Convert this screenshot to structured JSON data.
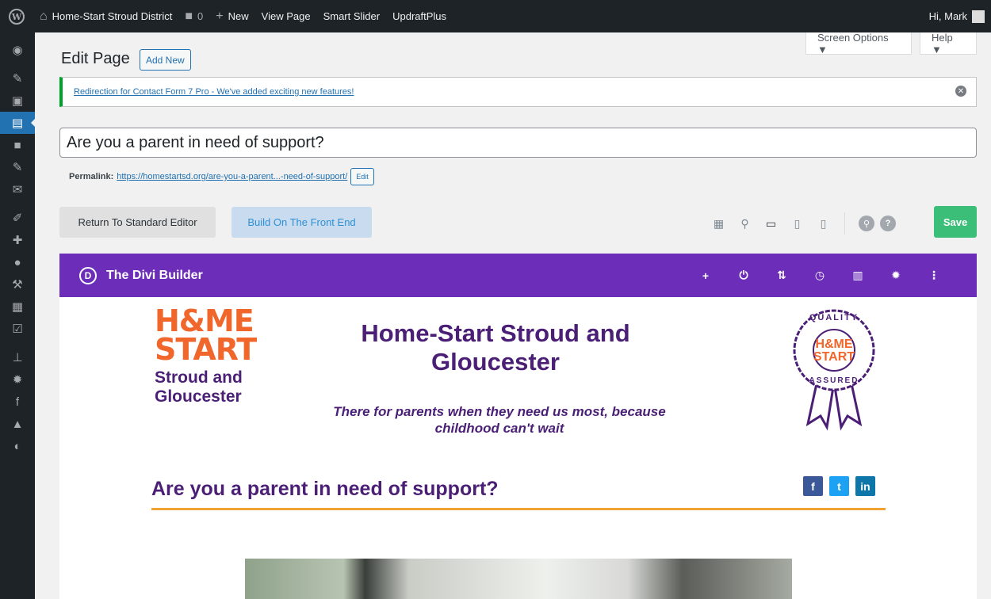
{
  "adminbar": {
    "site_name": "Home-Start Stroud District",
    "comments_count": "0",
    "new_label": "New",
    "view_page": "View Page",
    "smart_slider": "Smart Slider",
    "updraft": "UpdraftPlus",
    "greeting": "Hi, Mark"
  },
  "sidebar": {
    "icons": [
      "dashboard-icon",
      "pin-icon",
      "media-icon",
      "pages-icon",
      "comments-icon",
      "pin-icon",
      "mail-icon",
      "appearance-icon",
      "plugins-icon",
      "users-icon",
      "tools-icon",
      "blocks-icon",
      "check-icon",
      "sitemap-icon",
      "settings-icon",
      "facebook-icon",
      "learn-icon",
      "divi-icon"
    ]
  },
  "screen_options": "Screen Options ▼",
  "help": "Help ▼",
  "page": {
    "title": "Edit Page",
    "add_new": "Add New"
  },
  "notice": {
    "text": "Redirection for Contact Form 7 Pro - We've added exciting new features!"
  },
  "post_title": "Are you a parent in need of support?",
  "permalink": {
    "label": "Permalink:",
    "url": "https://homestartsd.org/are-you-a-parent...-need-of-support/",
    "edit": "Edit"
  },
  "toolbar": {
    "standard_editor": "Return To Standard Editor",
    "front_end": "Build On The Front End",
    "save": "Save"
  },
  "divi": {
    "logo": "D",
    "title": "The Divi Builder"
  },
  "content": {
    "logo_line1": "H&ME",
    "logo_line2": "START",
    "logo_sub": "Stroud and Gloucester",
    "heading": "Home-Start Stroud and Gloucester",
    "tagline": "There for parents when they need us most, because childhood can't wait",
    "badge_top": "QUALITY",
    "badge_mid1": "H&ME",
    "badge_mid2": "START",
    "badge_bottom": "ASSURED",
    "section_title": "Are you a parent in need of support?",
    "social": [
      "f",
      "t",
      "in"
    ]
  },
  "colors": {
    "adminbar": "#1d2327",
    "wp_blue": "#2271b1",
    "divi_purple": "#6c2eb9",
    "save_green": "#3bbe78",
    "brand_orange": "#f0662b",
    "brand_purple": "#4a1f75",
    "underline": "#f0a330"
  }
}
